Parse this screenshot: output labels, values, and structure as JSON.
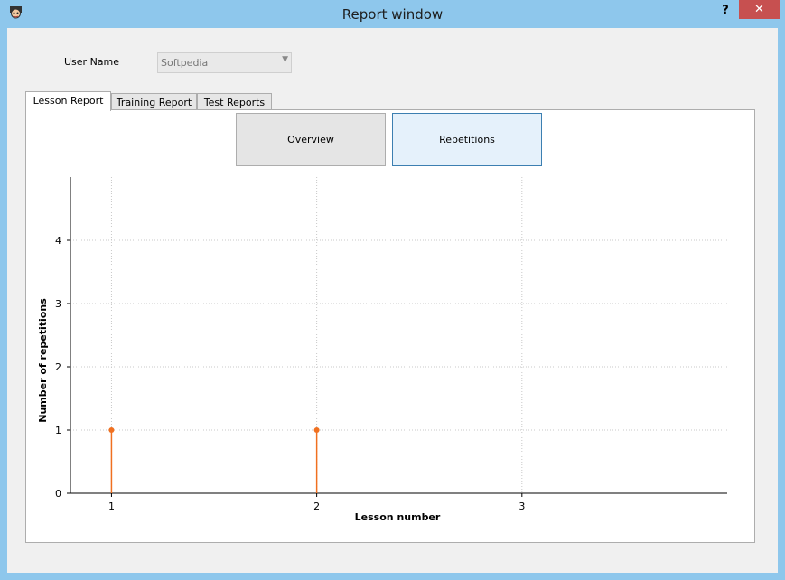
{
  "window": {
    "title": "Report window",
    "help_label": "?",
    "close_label": "✕"
  },
  "user": {
    "label": "User Name",
    "selected": "Softpedia"
  },
  "tabs": [
    {
      "label": "Lesson Report",
      "active": true
    },
    {
      "label": "Training Report",
      "active": false
    },
    {
      "label": "Test Reports",
      "active": false
    }
  ],
  "buttons": {
    "overview": "Overview",
    "repetitions": "Repetitions"
  },
  "colors": {
    "series": "#f07020",
    "accent": "#3c7fb1"
  },
  "chart_data": {
    "type": "scatter",
    "xlabel": "Lesson number",
    "ylabel": "Number of repetitions",
    "x_ticks": [
      1,
      2,
      3
    ],
    "y_ticks": [
      0,
      1,
      2,
      3,
      4
    ],
    "xlim": [
      0.8,
      4.0
    ],
    "ylim": [
      0,
      5
    ],
    "grid": true,
    "series": [
      {
        "x": [
          1,
          2
        ],
        "values": [
          1,
          1
        ]
      }
    ]
  }
}
